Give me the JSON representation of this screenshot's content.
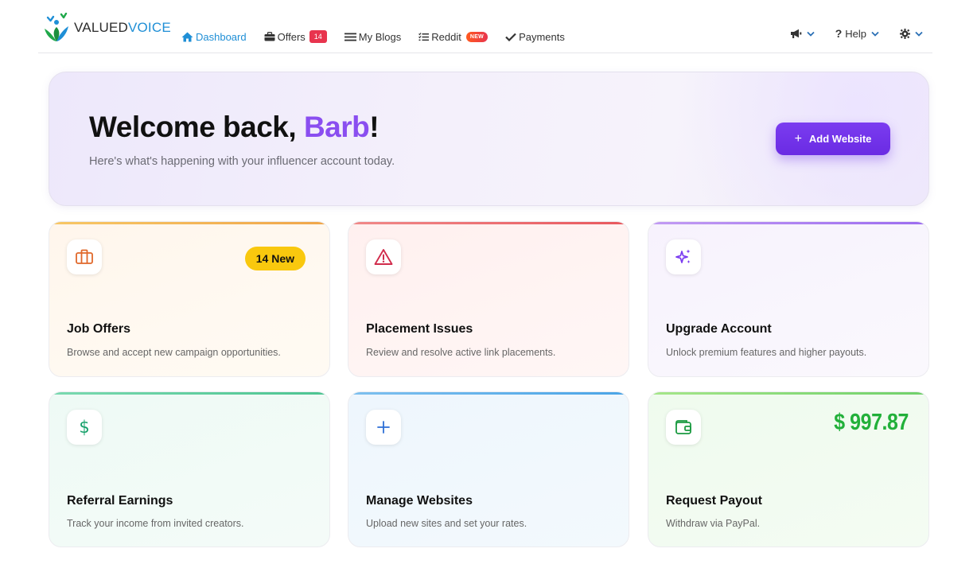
{
  "brand": {
    "name_part1": "VALUED",
    "name_part2": "VOICE"
  },
  "nav": {
    "dashboard": "Dashboard",
    "offers": "Offers",
    "offers_count": "14",
    "my_blogs": "My Blogs",
    "reddit": "Reddit",
    "reddit_badge": "NEW",
    "payments": "Payments",
    "help": "Help"
  },
  "hero": {
    "greeting": "Welcome back, ",
    "name": "Barb",
    "exclaim": "!",
    "subtitle": "Here's what's happening with your influencer account today.",
    "add_button": "Add Website"
  },
  "cards": [
    {
      "title": "Job Offers",
      "description": "Browse and accept new campaign opportunities.",
      "badge": "14 New",
      "icon": "briefcase-icon",
      "accent": "#f0b35a"
    },
    {
      "title": "Placement Issues",
      "description": "Review and resolve active link placements.",
      "icon": "warning-icon",
      "accent": "#ee7a7a"
    },
    {
      "title": "Upgrade Account",
      "description": "Unlock premium features and higher payouts.",
      "icon": "sparkles-icon",
      "accent": "#b48ef0"
    },
    {
      "title": "Referral Earnings",
      "description": "Track your income from invited creators.",
      "icon": "dollar-icon",
      "accent": "#6fd3a6"
    },
    {
      "title": "Manage Websites",
      "description": "Upload new sites and set your rates.",
      "icon": "plus-icon",
      "accent": "#74b8ec"
    },
    {
      "title": "Request Payout",
      "description": "Withdraw via PayPal.",
      "amount": "$ 997.87",
      "icon": "wallet-icon",
      "accent": "#8fdc8a"
    }
  ],
  "colors": {
    "primary": "#6a2be3",
    "nav_active": "#1f8fd6",
    "amount": "#22b03a",
    "badge_yellow": "#f9c80e"
  }
}
